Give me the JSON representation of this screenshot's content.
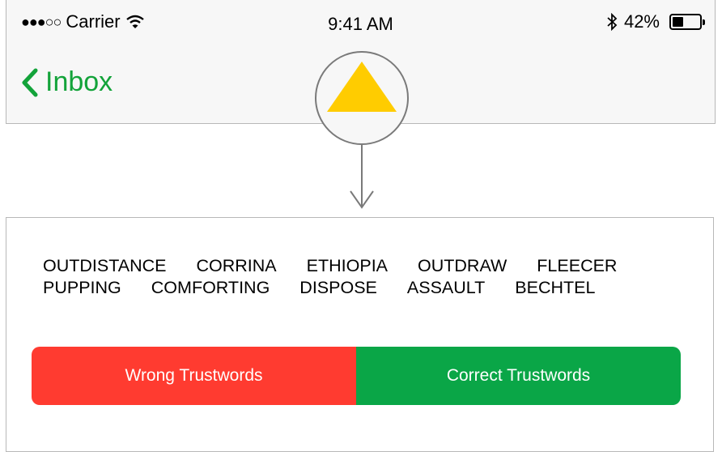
{
  "status_bar": {
    "carrier": "Carrier",
    "time": "9:41 AM",
    "battery": "42%",
    "battery_level": 0.42
  },
  "nav": {
    "back_label": "Inbox",
    "accent_color": "#13a33a"
  },
  "rating_icon": {
    "name": "yellow-triangle-icon",
    "color": "#ffcc00"
  },
  "trustwords": {
    "row1": [
      "OUTDISTANCE",
      "CORRINA",
      "ETHIOPIA",
      "OUTDRAW",
      "FLEECER"
    ],
    "row2": [
      "PUPPING",
      "COMFORTING",
      "DISPOSE",
      "ASSAULT",
      "BECHTEL"
    ]
  },
  "actions": {
    "wrong_label": "Wrong Trustwords",
    "wrong_color": "#ff3b30",
    "correct_label": "Correct Trustwords",
    "correct_color": "#0aa647"
  }
}
